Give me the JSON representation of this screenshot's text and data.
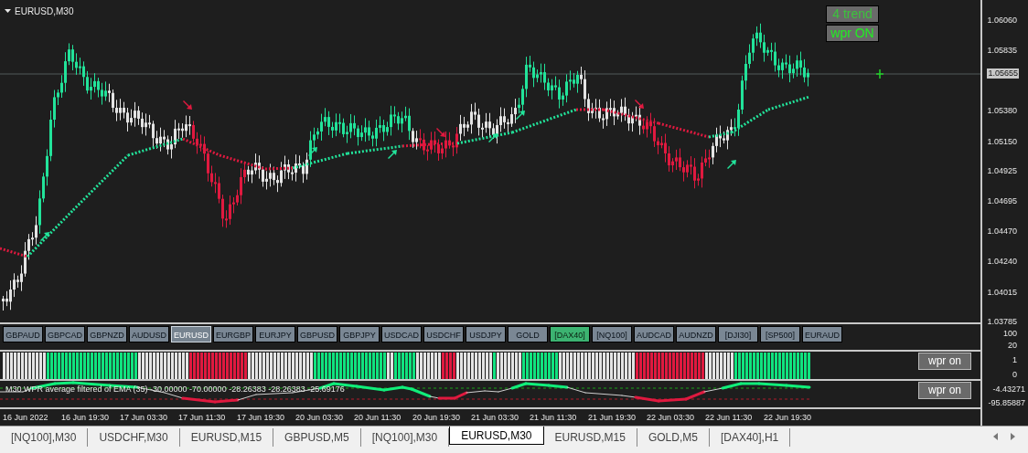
{
  "chart": {
    "title": "EURUSD,M30",
    "buttons": [
      {
        "label": "4 trend"
      },
      {
        "label": "wpr ON"
      }
    ],
    "price_labels": [
      "1.06060",
      "1.05835",
      "1.05380",
      "1.05150",
      "1.04925",
      "1.04695",
      "1.04470",
      "1.04240",
      "1.04015",
      "1.03785"
    ],
    "current_price": "1.05655"
  },
  "symbol_bar": {
    "buttons": [
      {
        "label": "GBPAUD",
        "selected": false,
        "marked": false
      },
      {
        "label": "GBPCAD",
        "selected": false,
        "marked": false
      },
      {
        "label": "GBPNZD",
        "selected": false,
        "marked": false
      },
      {
        "label": "AUDUSD",
        "selected": false,
        "marked": false
      },
      {
        "label": "EURUSD",
        "selected": true,
        "marked": false
      },
      {
        "label": "EURGBP",
        "selected": false,
        "marked": false
      },
      {
        "label": "EURJPY",
        "selected": false,
        "marked": false
      },
      {
        "label": "GBPUSD",
        "selected": false,
        "marked": false
      },
      {
        "label": "GBPJPY",
        "selected": false,
        "marked": false
      },
      {
        "label": "USDCAD",
        "selected": false,
        "marked": false
      },
      {
        "label": "USDCHF",
        "selected": false,
        "marked": false
      },
      {
        "label": "USDJPY",
        "selected": false,
        "marked": false
      },
      {
        "label": "GOLD",
        "selected": false,
        "marked": false
      },
      {
        "label": "[DAX40]",
        "selected": false,
        "marked": true
      },
      {
        "label": "[NQ100]",
        "selected": false,
        "marked": false
      },
      {
        "label": "AUDCAD",
        "selected": false,
        "marked": false
      },
      {
        "label": "AUDNZD",
        "selected": false,
        "marked": false
      },
      {
        "label": "[DJI30]",
        "selected": false,
        "marked": false
      },
      {
        "label": "[SP500]",
        "selected": false,
        "marked": false
      },
      {
        "label": "EURAUD",
        "selected": false,
        "marked": false
      }
    ],
    "axis_labels": [
      "100",
      "20"
    ]
  },
  "histogram_panel": {
    "button": "wpr on",
    "axis_labels": [
      "1",
      "0"
    ]
  },
  "wpr_panel": {
    "title": "M30 WPR average filtered of EMA (35) -30.00000 -70.00000 -28.26383 -28.26383 -25.69176",
    "button": "wpr on",
    "axis_labels": [
      "-4.43271",
      "-95.85887"
    ]
  },
  "time_axis": [
    "16 Jun 2022",
    "16 Jun 19:30",
    "17 Jun 03:30",
    "17 Jun 11:30",
    "17 Jun 19:30",
    "20 Jun 03:30",
    "20 Jun 11:30",
    "20 Jun 19:30",
    "21 Jun 03:30",
    "21 Jun 11:30",
    "21 Jun 19:30",
    "22 Jun 03:30",
    "22 Jun 11:30",
    "22 Jun 19:30"
  ],
  "tabs": [
    {
      "label": "[NQ100],M30",
      "selected": false
    },
    {
      "label": "USDCHF,M30",
      "selected": false
    },
    {
      "label": "EURUSD,M15",
      "selected": false
    },
    {
      "label": "GBPUSD,M5",
      "selected": false
    },
    {
      "label": "[NQ100],M30",
      "selected": false
    },
    {
      "label": "EURUSD,M30",
      "selected": true
    },
    {
      "label": "EURUSD,M15",
      "selected": false
    },
    {
      "label": "GOLD,M5",
      "selected": false
    },
    {
      "label": "[DAX40],H1",
      "selected": false
    }
  ]
}
